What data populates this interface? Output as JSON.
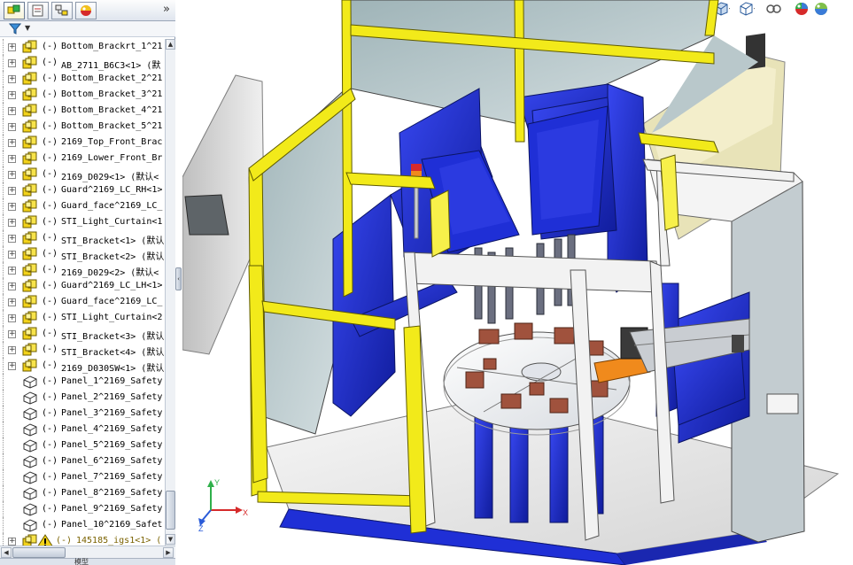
{
  "panel": {
    "tabs": [
      {
        "name": "feature-manager",
        "icon": "assembly-tree-icon"
      },
      {
        "name": "property-manager",
        "icon": "property-manager-icon"
      },
      {
        "name": "configuration-manager",
        "icon": "configuration-manager-icon"
      },
      {
        "name": "appearance-manager",
        "icon": "appearance-sphere-icon"
      }
    ],
    "expand_glyph": "»",
    "filter_icon": "funnel-filter-icon",
    "filter_caret": "▼",
    "tree_items": [
      {
        "status": "(-)",
        "label": "Bottom_Brackrt_1^21",
        "icon": "subassembly-icon",
        "expandable": true
      },
      {
        "status": "(-)",
        "label": "AB_2711_B6C3<1> (默",
        "icon": "subassembly-icon",
        "expandable": true
      },
      {
        "status": "(-)",
        "label": "Bottom_Bracket_2^21",
        "icon": "subassembly-icon",
        "expandable": true
      },
      {
        "status": "(-)",
        "label": "Bottom_Bracket_3^21",
        "icon": "subassembly-icon",
        "expandable": true
      },
      {
        "status": "(-)",
        "label": "Bottom_Bracket_4^21",
        "icon": "subassembly-icon",
        "expandable": true
      },
      {
        "status": "(-)",
        "label": "Bottom_Bracket_5^21",
        "icon": "subassembly-icon",
        "expandable": true
      },
      {
        "status": "(-)",
        "label": "2169_Top_Front_Brac",
        "icon": "subassembly-icon",
        "expandable": true
      },
      {
        "status": "(-)",
        "label": "2169_Lower_Front_Br",
        "icon": "subassembly-icon",
        "expandable": true
      },
      {
        "status": "(-)",
        "label": "2169_D029<1> (默认<",
        "icon": "subassembly-icon",
        "expandable": true
      },
      {
        "status": "(-)",
        "label": "Guard^2169_LC_RH<1>",
        "icon": "subassembly-icon",
        "expandable": true
      },
      {
        "status": "(-)",
        "label": "Guard_face^2169_LC_",
        "icon": "subassembly-icon",
        "expandable": true
      },
      {
        "status": "(-)",
        "label": "STI_Light_Curtain<1",
        "icon": "subassembly-icon",
        "expandable": true
      },
      {
        "status": "(-)",
        "label": "STI_Bracket<1> (默认",
        "icon": "subassembly-icon",
        "expandable": true
      },
      {
        "status": "(-)",
        "label": "STI_Bracket<2> (默认",
        "icon": "subassembly-icon",
        "expandable": true
      },
      {
        "status": "(-)",
        "label": "2169_D029<2> (默认<",
        "icon": "subassembly-icon",
        "expandable": true
      },
      {
        "status": "(-)",
        "label": "Guard^2169_LC_LH<1>",
        "icon": "subassembly-icon",
        "expandable": true
      },
      {
        "status": "(-)",
        "label": "Guard_face^2169_LC_",
        "icon": "subassembly-icon",
        "expandable": true
      },
      {
        "status": "(-)",
        "label": "STI_Light_Curtain<2",
        "icon": "subassembly-icon",
        "expandable": true
      },
      {
        "status": "(-)",
        "label": "STI_Bracket<3> (默认",
        "icon": "subassembly-icon",
        "expandable": true
      },
      {
        "status": "(-)",
        "label": "STI_Bracket<4> (默认",
        "icon": "subassembly-icon",
        "expandable": true
      },
      {
        "status": "(-)",
        "label": "2169_D030SW<1> (默认",
        "icon": "subassembly-icon",
        "expandable": true
      },
      {
        "status": "(-)",
        "label": "Panel_1^2169_Safety",
        "icon": "part-icon",
        "expandable": false
      },
      {
        "status": "(-)",
        "label": "Panel_2^2169_Safety",
        "icon": "part-icon",
        "expandable": false
      },
      {
        "status": "(-)",
        "label": "Panel_3^2169_Safety",
        "icon": "part-icon",
        "expandable": false
      },
      {
        "status": "(-)",
        "label": "Panel_4^2169_Safety",
        "icon": "part-icon",
        "expandable": false
      },
      {
        "status": "(-)",
        "label": "Panel_5^2169_Safety",
        "icon": "part-icon",
        "expandable": false
      },
      {
        "status": "(-)",
        "label": "Panel_6^2169_Safety",
        "icon": "part-icon",
        "expandable": false
      },
      {
        "status": "(-)",
        "label": "Panel_7^2169_Safety",
        "icon": "part-icon",
        "expandable": false
      },
      {
        "status": "(-)",
        "label": "Panel_8^2169_Safety",
        "icon": "part-icon",
        "expandable": false
      },
      {
        "status": "(-)",
        "label": "Panel_9^2169_Safety",
        "icon": "part-icon",
        "expandable": false
      },
      {
        "status": "(-)",
        "label": "Panel_10^2169_Safet",
        "icon": "part-icon",
        "expandable": false
      },
      {
        "status": "(-)",
        "label": "145185_igs1<1> (",
        "icon": "warning-icon",
        "expandable": true,
        "warning": true
      }
    ],
    "bottom_tab_label": "模型"
  },
  "splitter_glyph": "‹",
  "view_toolbar": [
    {
      "name": "zoom-to-fit",
      "icon": "zoom-to-fit-icon"
    },
    {
      "name": "zoom-to-area",
      "icon": "zoom-to-area-icon"
    },
    {
      "name": "previous-view",
      "icon": "previous-view-icon"
    },
    {
      "name": "section-view",
      "icon": "section-view-icon"
    },
    {
      "name": "view-orientation",
      "icon": "view-orientation-icon"
    },
    {
      "name": "display-style",
      "icon": "display-style-icon"
    },
    {
      "name": "hide-show-items",
      "icon": "hide-show-items-icon"
    },
    {
      "name": "edit-appearance",
      "icon": "edit-appearance-icon"
    },
    {
      "name": "apply-scene",
      "icon": "apply-scene-icon"
    }
  ],
  "triad": {
    "x_label": "X",
    "y_label": "Y",
    "z_label": "Z"
  },
  "colors": {
    "frame_blue": "#1f2fd6",
    "guard_yellow": "#f2ea1a",
    "panel_grey": "#c8d3d6",
    "cabinet_grey": "#d9d9d9",
    "fixture_rust": "#a0523d",
    "accent_orange": "#f08a1c"
  }
}
